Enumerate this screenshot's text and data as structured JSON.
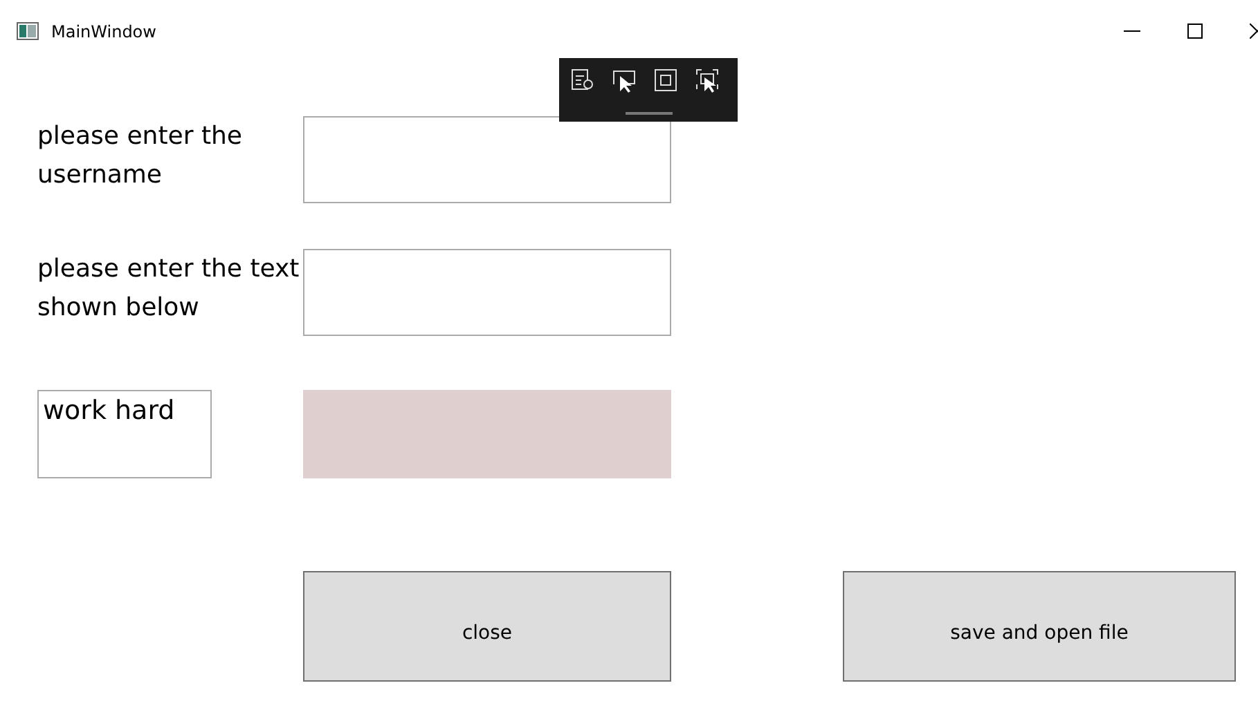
{
  "window": {
    "title": "MainWindow"
  },
  "fields": [
    {
      "label": "please enter the username"
    },
    {
      "label": "please enter the text shown below"
    }
  ],
  "captcha": {
    "text": "work hard"
  },
  "buttons": [
    {
      "label": "close"
    },
    {
      "label": "save and open file"
    }
  ]
}
